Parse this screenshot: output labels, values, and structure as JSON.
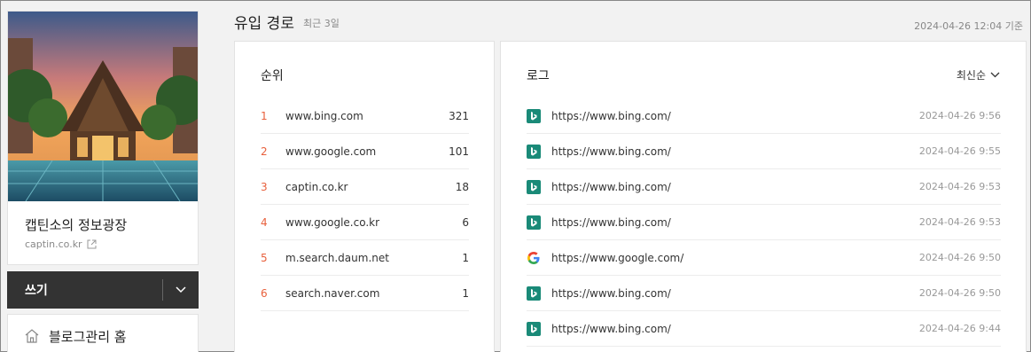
{
  "sidebar": {
    "blog_name": "캡틴소의 정보광장",
    "blog_url": "captin.co.kr",
    "write_label": "쓰기",
    "manage_home_label": "블로그관리 홈"
  },
  "header": {
    "title": "유입 경로",
    "subtitle": "최근 3일",
    "timestamp": "2024-04-26 12:04 기준"
  },
  "ranking": {
    "title": "순위",
    "rows": [
      {
        "rank": "1",
        "domain": "www.bing.com",
        "count": "321"
      },
      {
        "rank": "2",
        "domain": "www.google.com",
        "count": "101"
      },
      {
        "rank": "3",
        "domain": "captin.co.kr",
        "count": "18"
      },
      {
        "rank": "4",
        "domain": "www.google.co.kr",
        "count": "6"
      },
      {
        "rank": "5",
        "domain": "m.search.daum.net",
        "count": "1"
      },
      {
        "rank": "6",
        "domain": "search.naver.com",
        "count": "1"
      }
    ]
  },
  "log": {
    "title": "로그",
    "sort_label": "최신순",
    "rows": [
      {
        "icon": "bing-icon",
        "url": "https://www.bing.com/",
        "time": "2024-04-26 9:56"
      },
      {
        "icon": "bing-icon",
        "url": "https://www.bing.com/",
        "time": "2024-04-26 9:55"
      },
      {
        "icon": "bing-icon",
        "url": "https://www.bing.com/",
        "time": "2024-04-26 9:53"
      },
      {
        "icon": "bing-icon",
        "url": "https://www.bing.com/",
        "time": "2024-04-26 9:53"
      },
      {
        "icon": "google-icon",
        "url": "https://www.google.com/",
        "time": "2024-04-26 9:50"
      },
      {
        "icon": "bing-icon",
        "url": "https://www.bing.com/",
        "time": "2024-04-26 9:50"
      },
      {
        "icon": "bing-icon",
        "url": "https://www.bing.com/",
        "time": "2024-04-26 9:44"
      }
    ]
  },
  "colors": {
    "rank_accent": "#e8603c",
    "bing_green": "#1a8a78",
    "write_bar": "#333333"
  }
}
